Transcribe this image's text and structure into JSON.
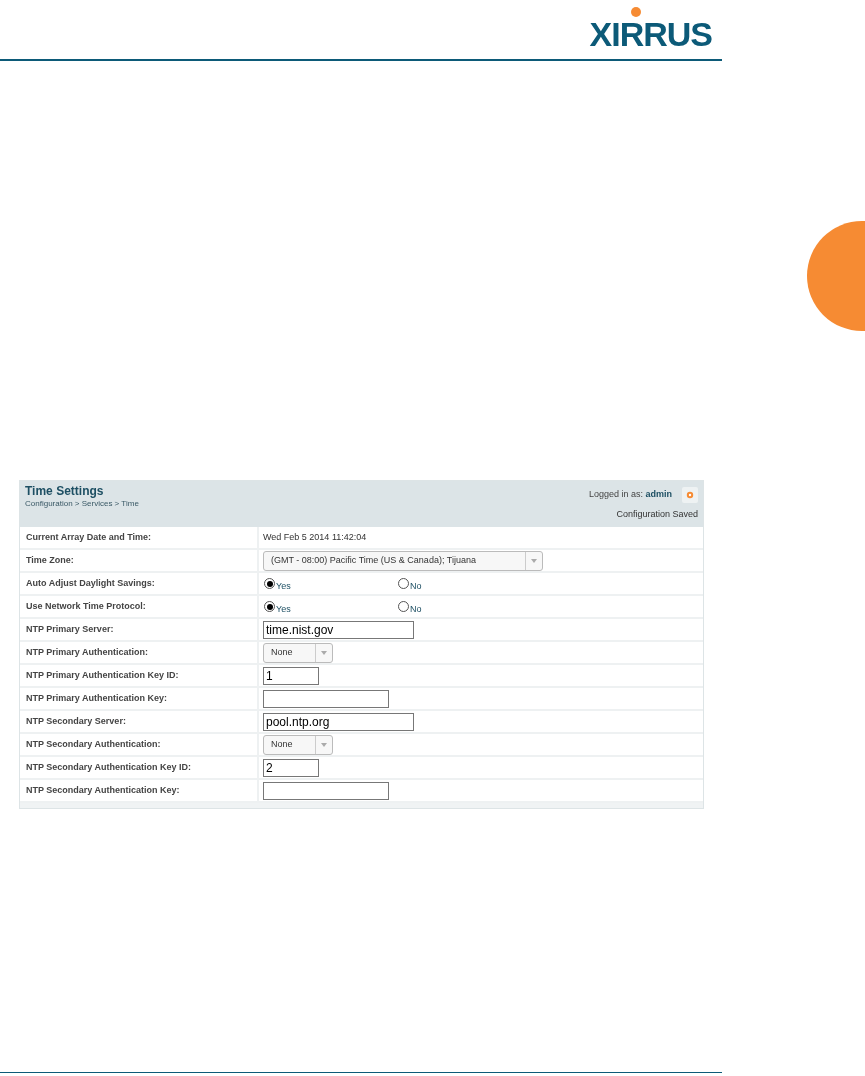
{
  "logo": {
    "text": "XIRRUS"
  },
  "panel": {
    "title": "Time Settings",
    "breadcrumb": "Configuration > Services > Time",
    "logged_in_label": "Logged in as:",
    "user": "admin",
    "status": "Configuration Saved"
  },
  "rows": [
    {
      "label": "Current Array Date and Time:",
      "kind": "text",
      "value": "Wed Feb 5 2014 11:42:04"
    },
    {
      "label": "Time Zone:",
      "kind": "select",
      "value": "(GMT - 08:00) Pacific Time (US & Canada); Tijuana"
    },
    {
      "label": "Auto Adjust Daylight Savings:",
      "kind": "radio",
      "options": [
        {
          "label": "Yes",
          "selected": true
        },
        {
          "label": "No",
          "selected": false
        }
      ]
    },
    {
      "label": "Use Network Time Protocol:",
      "kind": "radio",
      "options": [
        {
          "label": "Yes",
          "selected": true
        },
        {
          "label": "No",
          "selected": false
        }
      ]
    },
    {
      "label": "NTP Primary Server:",
      "kind": "server",
      "value": "time.nist.gov"
    },
    {
      "label": "NTP Primary Authentication:",
      "kind": "auth",
      "value": "None"
    },
    {
      "label": "NTP Primary Authentication Key ID:",
      "kind": "keyid",
      "value": "1"
    },
    {
      "label": "NTP Primary Authentication Key:",
      "kind": "key",
      "value": ""
    },
    {
      "label": "NTP Secondary Server:",
      "kind": "server",
      "value": "pool.ntp.org"
    },
    {
      "label": "NTP Secondary Authentication:",
      "kind": "auth",
      "value": "None"
    },
    {
      "label": "NTP Secondary Authentication Key ID:",
      "kind": "keyid",
      "value": "2"
    },
    {
      "label": "NTP Secondary Authentication Key:",
      "kind": "key",
      "value": ""
    }
  ]
}
